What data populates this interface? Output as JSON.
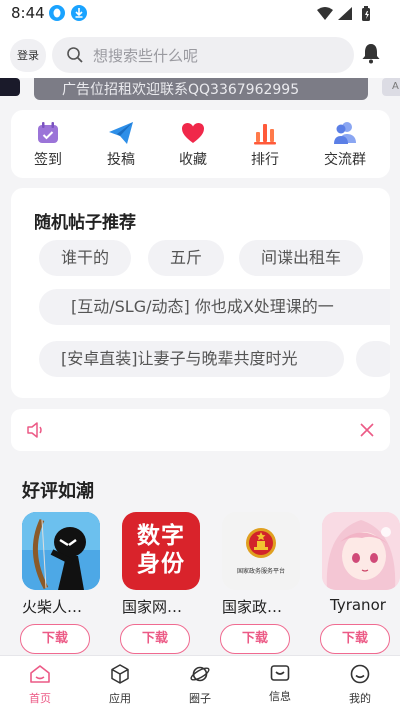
{
  "status_bar": {
    "time": "8:44",
    "icons": [
      "qq-notification-icon",
      "download-icon",
      "wifi-icon",
      "signal-icon",
      "battery-icon"
    ]
  },
  "header": {
    "login_label": "登录",
    "search_placeholder": "想搜索些什么呢",
    "icons": [
      "search-icon",
      "bell-icon"
    ]
  },
  "banner": {
    "text": "广告位招租欢迎联系QQ3367962995",
    "right_fragment": "A"
  },
  "quick_nav": [
    {
      "label": "签到",
      "icon": "calendar-check-icon",
      "color": "#9b74d8"
    },
    {
      "label": "投稿",
      "icon": "paper-plane-icon",
      "color": "#2e8fe8"
    },
    {
      "label": "收藏",
      "icon": "heart-icon",
      "color": "#f0284a"
    },
    {
      "label": "排行",
      "icon": "bar-chart-icon",
      "color": "#ff5a3a"
    },
    {
      "label": "交流群",
      "icon": "users-icon",
      "color": "#5b7fe6"
    }
  ],
  "random_posts": {
    "title": "随机帖子推荐",
    "tags": [
      "谁干的",
      "五斤",
      "间谍出租车",
      "[互动/SLG/动态] 你也成X处理课的一",
      "[安卓直装]让妻子与晚辈共度时光"
    ]
  },
  "notice": {
    "icons": [
      "speaker-icon",
      "close-icon"
    ]
  },
  "good_reviews": {
    "title": "好评如潮",
    "download_label": "下载",
    "apps": [
      {
        "name": "火柴人…",
        "icon": "stickman-archer-icon"
      },
      {
        "name": "国家网…",
        "icon": "digital-identity-icon",
        "icon_text": "数字身份",
        "color": "#d9232b"
      },
      {
        "name": "国家政…",
        "icon": "national-emblem-icon",
        "icon_caption": "国家政务服务平台"
      },
      {
        "name": "Tyranor",
        "icon": "anime-girl-icon"
      }
    ]
  },
  "bottom_nav": [
    {
      "label": "首页",
      "icon": "home-icon",
      "active": true
    },
    {
      "label": "应用",
      "icon": "cube-icon",
      "active": false
    },
    {
      "label": "圈子",
      "icon": "planet-icon",
      "active": false
    },
    {
      "label": "信息",
      "icon": "message-icon",
      "active": false
    },
    {
      "label": "我的",
      "icon": "profile-icon",
      "active": false
    }
  ],
  "colors": {
    "accent": "#ec5a86",
    "background": "#f4f4f6"
  }
}
